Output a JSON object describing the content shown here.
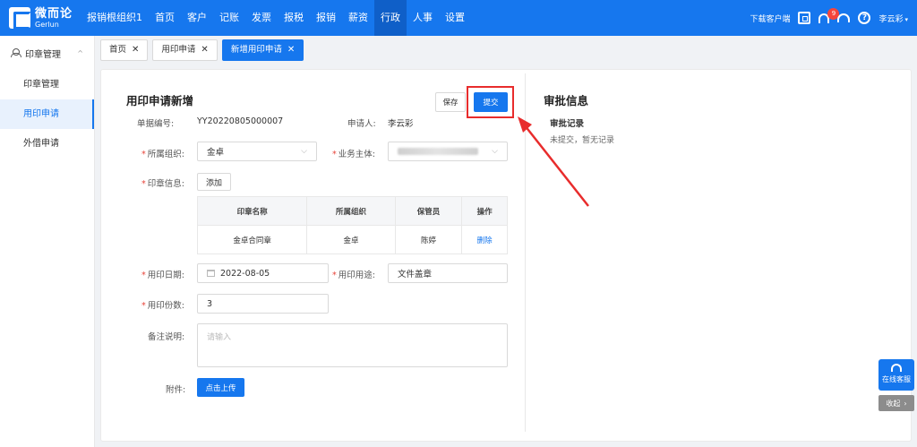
{
  "brand": {
    "name_cn": "微而论",
    "name_en": "Gerlun",
    "accent": "#1677ee",
    "highlight": "#e82c2c"
  },
  "topnav": {
    "items": [
      "报销根组织1",
      "首页",
      "客户",
      "记账",
      "发票",
      "报税",
      "报销",
      "薪资",
      "行政",
      "人事",
      "设置"
    ],
    "active_index": 8,
    "download": "下载客户端",
    "notification_count": "9",
    "user": "李云彩",
    "icons": [
      "scan-icon",
      "bell-icon",
      "headset-icon",
      "help-icon"
    ]
  },
  "sidebar": {
    "group": "印章管理",
    "items": [
      "印章管理",
      "用印申请",
      "外借申请"
    ],
    "active_index": 1
  },
  "tabs": [
    {
      "label": "首页",
      "active": false
    },
    {
      "label": "用印申请",
      "active": false
    },
    {
      "label": "新增用印申请",
      "active": true
    }
  ],
  "form": {
    "title": "用印申请新增",
    "save": "保存",
    "submit": "提交",
    "doc_no_label": "单据编号:",
    "doc_no": "YY20220805000007",
    "applicant_label": "申请人:",
    "applicant": "李云彩",
    "org_label": "所属组织:",
    "org_value": "金卓",
    "biz_label": "业务主体:",
    "seal_info_label": "印章信息:",
    "add_button": "添加",
    "table": {
      "headers": [
        "印章名称",
        "所属组织",
        "保管员",
        "操作"
      ],
      "rows": [
        [
          "金卓合同章",
          "金卓",
          "陈婷",
          "删除"
        ]
      ]
    },
    "date_label": "用印日期:",
    "date_value": "2022-08-05",
    "purpose_label": "用印用途:",
    "purpose_value": "文件盖章",
    "count_label": "用印份数:",
    "count_value": "3",
    "note_label": "备注说明:",
    "note_placeholder": "请输入",
    "attach_label": "附件:",
    "upload_button": "点击上传"
  },
  "approval": {
    "title": "审批信息",
    "record_title": "审批记录",
    "record_text": "未提交，暂无记录"
  },
  "float": {
    "service": "在线客服",
    "collapse": "收起"
  }
}
